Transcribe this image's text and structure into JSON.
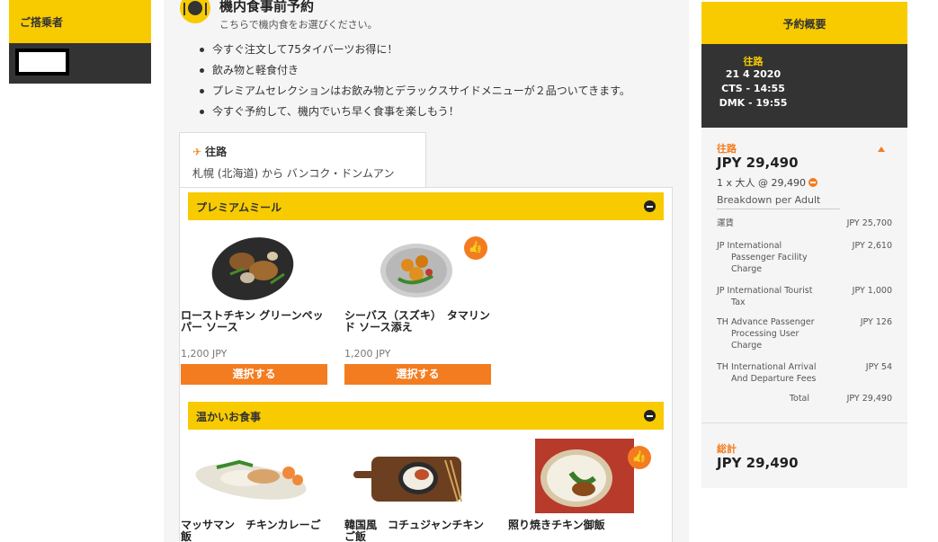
{
  "passenger": {
    "header": "ご搭乗者"
  },
  "main": {
    "title": "機内食事前予約",
    "subtitle": "こちらで機内食をお選びください。",
    "bullets": [
      "今すぐ注文して75タイバーツお得に！",
      "飲み物と軽食付き",
      "プレミアムセレクションはお飲み物とデラックスサイドメニューが２品ついてきます。",
      "今すぐ予約して、機内でいち早く食事を楽しもう！"
    ],
    "flight_tab": {
      "direction": "往路",
      "route": "札幌 (北海道) から バンコク・ドンムアン"
    },
    "categories": [
      {
        "label": "プレミアムミール",
        "items": [
          {
            "name": "ローストチキン グリーンペッパー ソース",
            "price": "1,200 JPY",
            "button": "選択する",
            "recommended": false
          },
          {
            "name": "シーバス（スズキ）　タマリンド ソース添え",
            "price": "1,200 JPY",
            "button": "選択する",
            "recommended": true
          }
        ]
      },
      {
        "label": "温かいお食事",
        "items": [
          {
            "name": "マッサマン　チキンカレーご飯",
            "recommended": false
          },
          {
            "name": "韓国風　コチュジャンチキンご飯",
            "recommended": false
          },
          {
            "name": "照り焼きチキン御飯",
            "recommended": true
          }
        ]
      }
    ]
  },
  "summary": {
    "header": "予約概要",
    "flight": {
      "direction": "往路",
      "date": "21 4 2020",
      "departure": "CTS - 14:55",
      "arrival": "DMK - 19:55"
    },
    "direction": "往路",
    "total": "JPY 29,490",
    "pax": "1 x 大人 @ 29,490",
    "breakdown_label": "Breakdown per Adult",
    "fees": [
      {
        "label_line1": "運賃",
        "label_rest": "",
        "amount": "JPY 25,700"
      },
      {
        "label_line1": "JP International",
        "label_rest": "Passenger Facility Charge",
        "amount": "JPY 2,610"
      },
      {
        "label_line1": "JP International Tourist",
        "label_rest": "Tax",
        "amount": "JPY 1,000"
      },
      {
        "label_line1": "TH Advance Passenger",
        "label_rest": "Processing User Charge",
        "amount": "JPY 126"
      },
      {
        "label_line1": "TH International Arrival",
        "label_rest": "And Departure Fees",
        "amount": "JPY 54"
      }
    ],
    "fee_total_label": "Total",
    "fee_total": "JPY 29,490",
    "grand_label": "総計",
    "grand_total": "JPY 29,490"
  },
  "colors": {
    "brand_yellow": "#f8cb00",
    "accent_orange": "#f47c20",
    "dark": "#333333"
  },
  "icons": [
    "meal-icon",
    "plane-icon",
    "collapse-icon",
    "thumbs-up-icon",
    "minus-icon",
    "caret-up-icon"
  ]
}
